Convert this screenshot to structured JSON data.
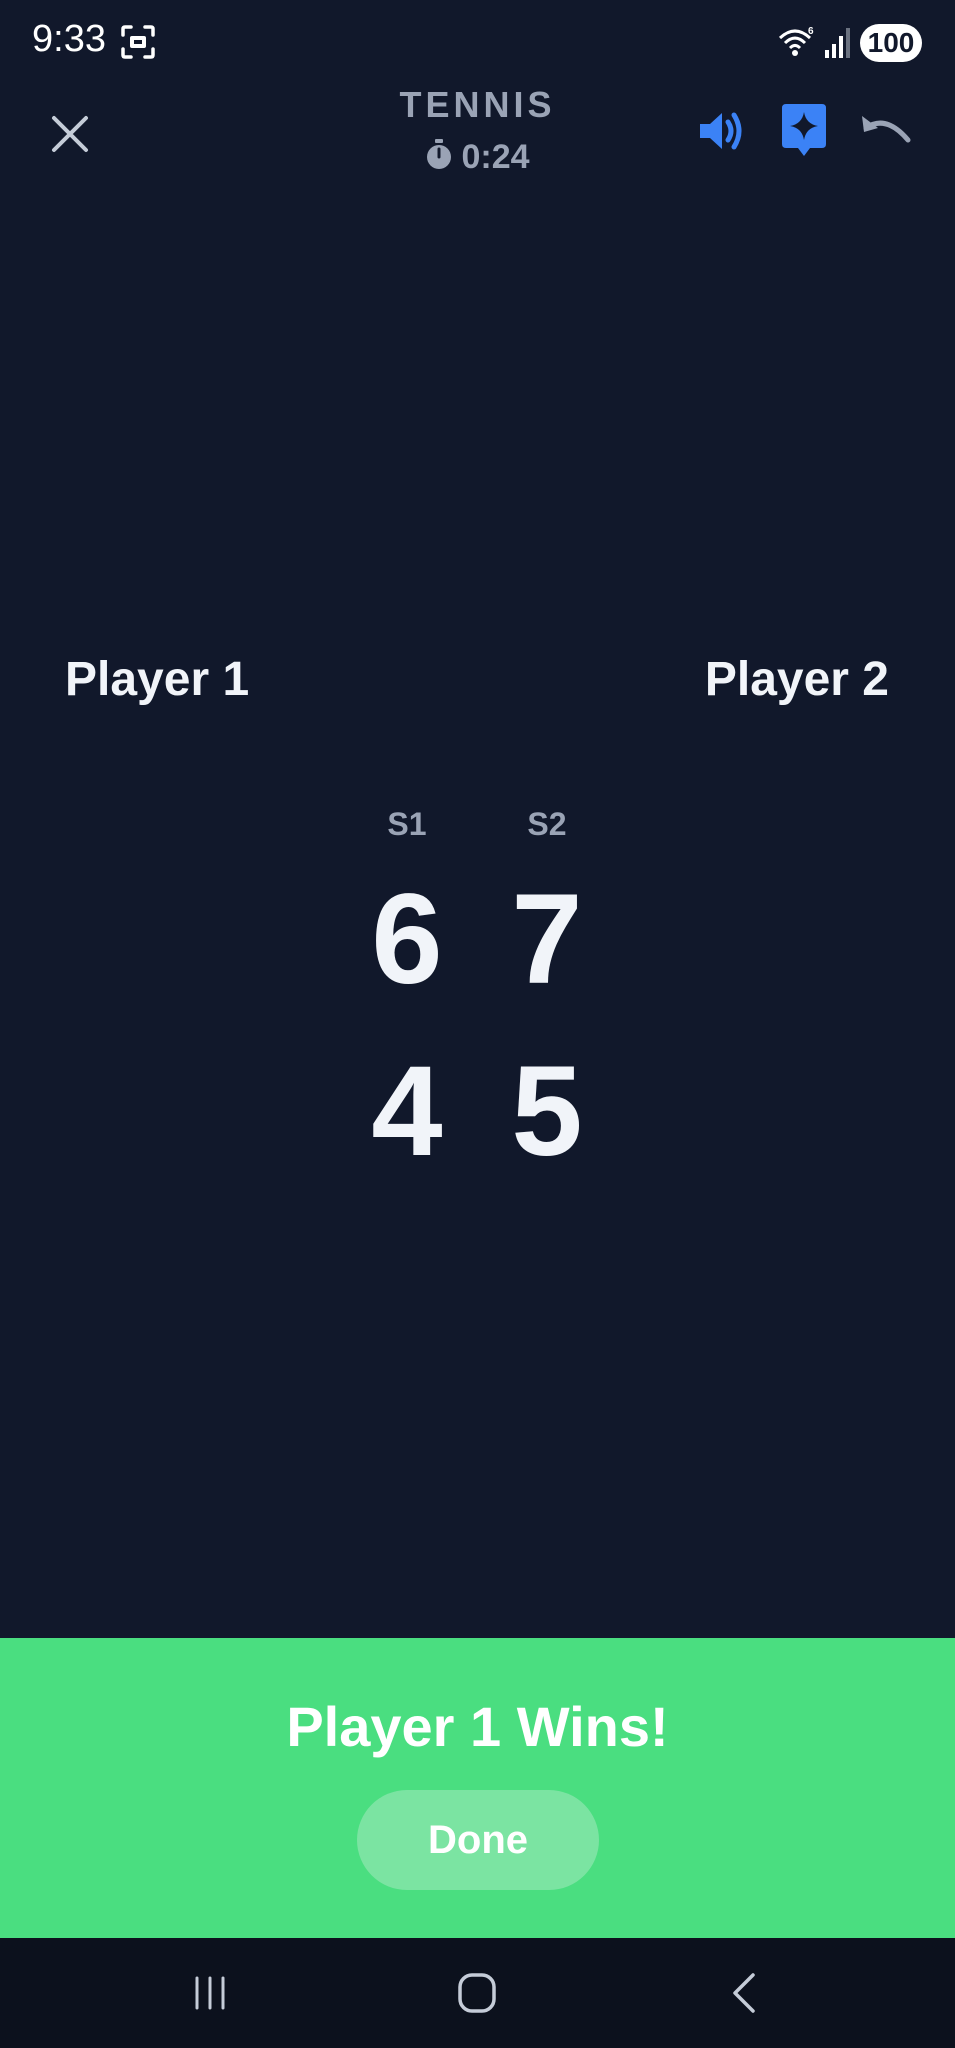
{
  "status_bar": {
    "time": "9:33",
    "battery": "100",
    "icons": [
      "screen-record-icon",
      "wifi-icon",
      "signal-icon"
    ]
  },
  "header": {
    "title": "TENNIS",
    "timer": "0:24",
    "icons": [
      "close-icon",
      "stopwatch-icon",
      "sound-icon",
      "ai-sparkle-icon",
      "undo-icon"
    ]
  },
  "players": {
    "player1": "Player 1",
    "player2": "Player 2"
  },
  "sets": {
    "labels": [
      "S1",
      "S2"
    ],
    "player1": [
      "6",
      "7"
    ],
    "player2": [
      "4",
      "5"
    ]
  },
  "result": {
    "message": "Player 1 Wins!",
    "done_label": "Done"
  },
  "nav_bar": {
    "icons": [
      "recents-icon",
      "home-icon",
      "back-icon"
    ]
  },
  "colors": {
    "background": "#11182b",
    "accent": "#3b82f6",
    "win_banner": "#4ade80",
    "done_button": "#7be4a2",
    "muted_text": "#9aa3b5"
  }
}
